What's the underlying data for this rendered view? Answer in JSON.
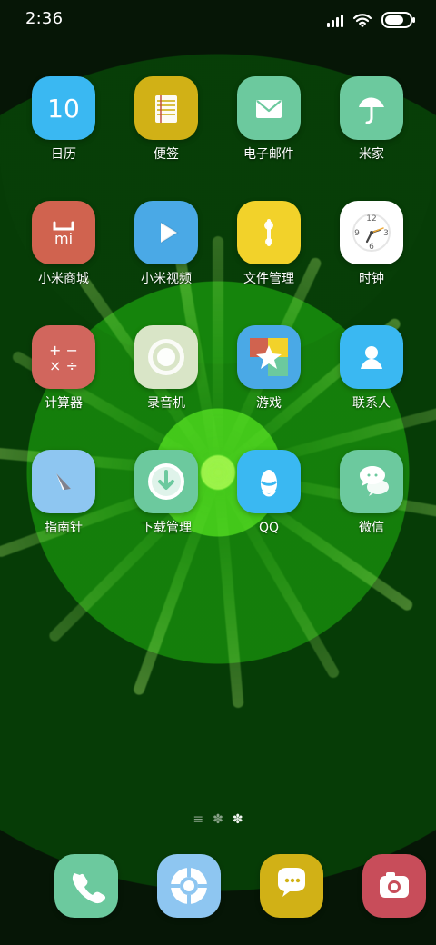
{
  "status_bar": {
    "time": "2:36",
    "signal_bars": 4,
    "wifi": "wifi-icon",
    "battery_level_percent": 90
  },
  "home": {
    "apps": [
      {
        "id": "calendar",
        "label": "日历",
        "icon": "calendar-icon",
        "bg": "#3ab8f2",
        "icon_text": "10"
      },
      {
        "id": "notes",
        "label": "便签",
        "icon": "notes-icon",
        "bg": "#d1b116"
      },
      {
        "id": "email",
        "label": "电子邮件",
        "icon": "mail-icon",
        "bg": "#6cc99e"
      },
      {
        "id": "mihome",
        "label": "米家",
        "icon": "umbrella-icon",
        "bg": "#6cc99e"
      },
      {
        "id": "mistore",
        "label": "小米商城",
        "icon": "mi-store-icon",
        "bg": "#d0634f",
        "icon_text": "mi"
      },
      {
        "id": "mivideo",
        "label": "小米视频",
        "icon": "play-icon",
        "bg": "#4aa9e6"
      },
      {
        "id": "files",
        "label": "文件管理",
        "icon": "file-manager-icon",
        "bg": "#f2d22a"
      },
      {
        "id": "clock",
        "label": "时钟",
        "icon": "clock-icon",
        "bg": "#ffffff",
        "clock_numbers": [
          "12",
          "3",
          "6",
          "9"
        ]
      },
      {
        "id": "calculator",
        "label": "计算器",
        "icon": "calculator-icon",
        "bg": "#d1665d",
        "icon_text": "+ −\n× ÷"
      },
      {
        "id": "recorder",
        "label": "录音机",
        "icon": "recorder-icon",
        "bg": "#d9e5c7"
      },
      {
        "id": "games",
        "label": "游戏",
        "icon": "star-icon",
        "bg": "#4aa9e6"
      },
      {
        "id": "contacts",
        "label": "联系人",
        "icon": "contacts-icon",
        "bg": "#3ab8f2"
      },
      {
        "id": "compass",
        "label": "指南针",
        "icon": "compass-icon",
        "bg": "#8ec6f1"
      },
      {
        "id": "downloads",
        "label": "下载管理",
        "icon": "download-icon",
        "bg": "#6cc99e"
      },
      {
        "id": "qq",
        "label": "QQ",
        "icon": "qq-icon",
        "bg": "#3ab8f2"
      },
      {
        "id": "wechat",
        "label": "微信",
        "icon": "wechat-icon",
        "bg": "#6cc99e"
      }
    ]
  },
  "pager": {
    "items": [
      "≡",
      "✽",
      "✽"
    ],
    "active_index": 2
  },
  "dock": {
    "apps": [
      {
        "id": "phone",
        "icon": "phone-icon",
        "bg": "#6cc99e"
      },
      {
        "id": "browser",
        "icon": "browser-icon",
        "bg": "#8ec6f1"
      },
      {
        "id": "messages",
        "icon": "messages-icon",
        "bg": "#d1b116"
      },
      {
        "id": "camera",
        "icon": "camera-icon",
        "bg": "#c84d5a"
      }
    ]
  }
}
